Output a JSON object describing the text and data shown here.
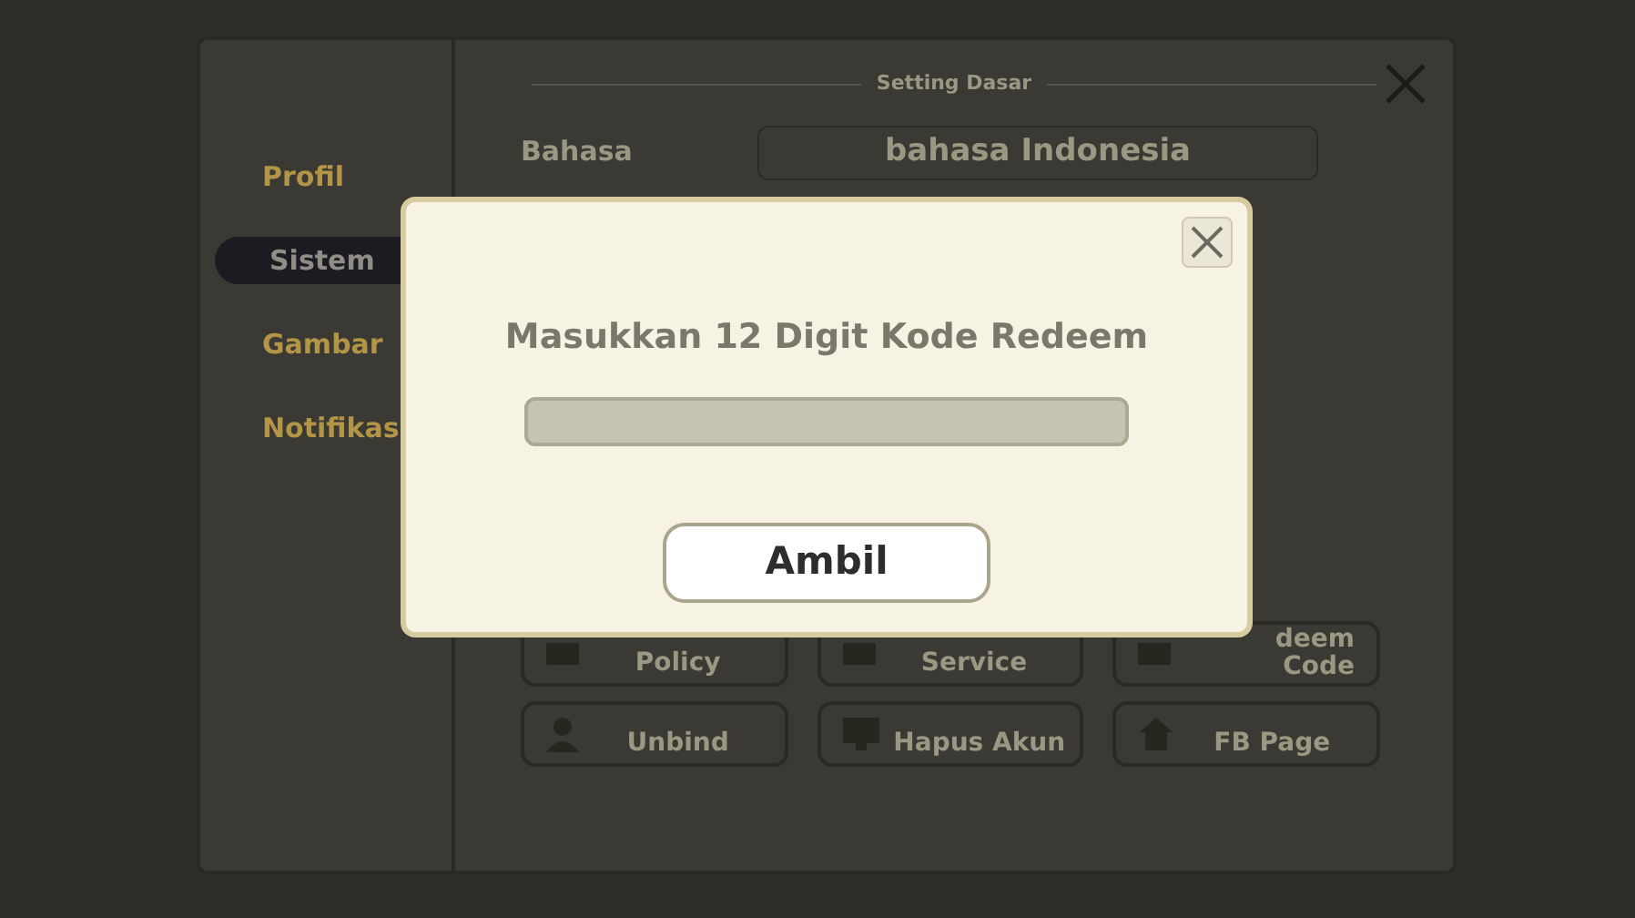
{
  "settings_panel": {
    "sidebar": [
      {
        "label": "Profil",
        "selected": false
      },
      {
        "label": "Sistem",
        "selected": true
      },
      {
        "label": "Gambar",
        "selected": false
      },
      {
        "label": "Notifikas",
        "selected": false
      }
    ],
    "section_title": "Setting Dasar",
    "language": {
      "label": "Bahasa",
      "value": "bahasa Indonesia"
    },
    "buttons": [
      {
        "kind": "card",
        "lines": [
          "Policy"
        ]
      },
      {
        "kind": "card",
        "lines": [
          "Service"
        ]
      },
      {
        "kind": "card",
        "lines": [
          "deem",
          "Code"
        ]
      },
      {
        "kind": "user",
        "lines": [
          "Unbind"
        ]
      },
      {
        "kind": "monitor",
        "lines": [
          "Hapus Akun"
        ]
      },
      {
        "kind": "home",
        "lines": [
          "FB Page"
        ]
      }
    ]
  },
  "redeem_dialog": {
    "title": "Masukkan 12 Digit Kode Redeem",
    "button": "Ambil"
  }
}
